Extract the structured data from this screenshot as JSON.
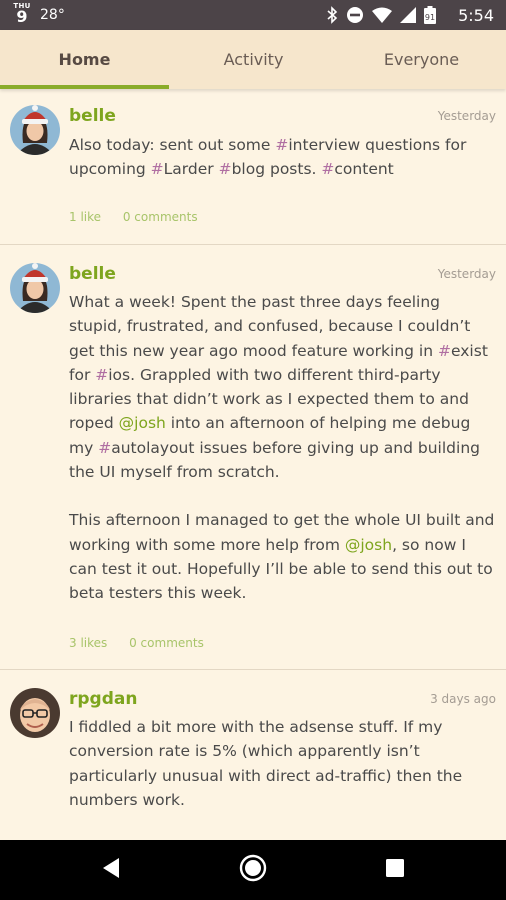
{
  "status": {
    "dow": "THU",
    "day": "9",
    "temperature": "28°",
    "battery_level": "91",
    "time": "5:54"
  },
  "tabs": [
    {
      "label": "Home",
      "active": true
    },
    {
      "label": "Activity",
      "active": false
    },
    {
      "label": "Everyone",
      "active": false
    }
  ],
  "posts": [
    {
      "username": "belle",
      "timestamp": "Yesterday",
      "body": [
        [
          [
            "Also today: sent out some ",
            ""
          ],
          [
            "#",
            "hash"
          ],
          [
            "interview questions for upcoming ",
            ""
          ],
          [
            "#",
            "hash"
          ],
          [
            "Larder ",
            ""
          ],
          [
            "#",
            "hash"
          ],
          [
            "blog posts. ",
            ""
          ],
          [
            "#",
            "hash"
          ],
          [
            "content",
            ""
          ]
        ]
      ],
      "likes": "1 like",
      "comments": "0 comments"
    },
    {
      "username": "belle",
      "timestamp": "Yesterday",
      "body": [
        [
          [
            "What a week! Spent the past three days feeling stupid, frustrated, and confused, because I couldn’t get this new year ago mood feature working in ",
            ""
          ],
          [
            "#",
            "hash"
          ],
          [
            "exist for ",
            ""
          ],
          [
            "#",
            "hash"
          ],
          [
            "ios. Grappled with two different third-party libraries that didn’t work as I expected them to and roped ",
            ""
          ],
          [
            "@josh",
            "mention"
          ],
          [
            " into an afternoon of helping me debug my ",
            ""
          ],
          [
            "#",
            "hash"
          ],
          [
            "autolayout issues before giving up and building the UI myself from scratch.",
            ""
          ]
        ],
        [
          [
            "This afternoon I managed to get the whole UI built and working with some more help from ",
            ""
          ],
          [
            "@josh",
            "mention"
          ],
          [
            ", so now I can test it out. Hopefully I’ll be able to send this out to beta testers this week.",
            ""
          ]
        ]
      ],
      "likes": "3 likes",
      "comments": "0 comments"
    },
    {
      "username": "rpgdan",
      "timestamp": "3 days ago",
      "body": [
        [
          [
            "I fiddled a bit more with the adsense stuff. If my conversion rate is 5% (which apparently isn’t particularly unusual with direct ad-traffic) then the numbers work.",
            ""
          ]
        ]
      ],
      "likes": "",
      "comments": ""
    }
  ],
  "colors": {
    "accent_green": "#7ea51e",
    "hashtag_purple": "#b06fa2",
    "background": "#fdf4e3",
    "tabbar": "#f6e6cc"
  }
}
